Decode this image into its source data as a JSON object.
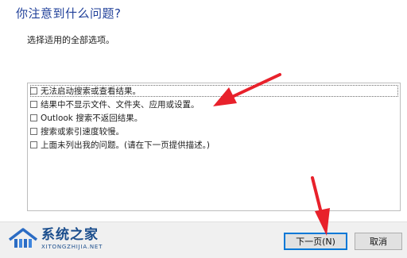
{
  "dialog": {
    "title": "你注意到什么问题?",
    "instruction": "选择适用的全部选项。"
  },
  "options": [
    {
      "label": "无法启动搜索或查看结果。",
      "checked": false
    },
    {
      "label": "结果中不显示文件、文件夹、应用或设置。",
      "checked": false
    },
    {
      "label": "Outlook 搜索不返回结果。",
      "checked": false
    },
    {
      "label": "搜索或索引速度较慢。",
      "checked": false
    },
    {
      "label": "上面未列出我的问题。(请在下一页提供描述。)",
      "checked": false
    }
  ],
  "buttons": {
    "next": "下一页(N)",
    "cancel": "取消"
  },
  "watermark": {
    "name": "系统之家",
    "url": "XITONGZHIJIA.NET"
  },
  "colors": {
    "title": "#1f3f99",
    "arrow": "#e8212b",
    "primary_border": "#0078d7"
  }
}
